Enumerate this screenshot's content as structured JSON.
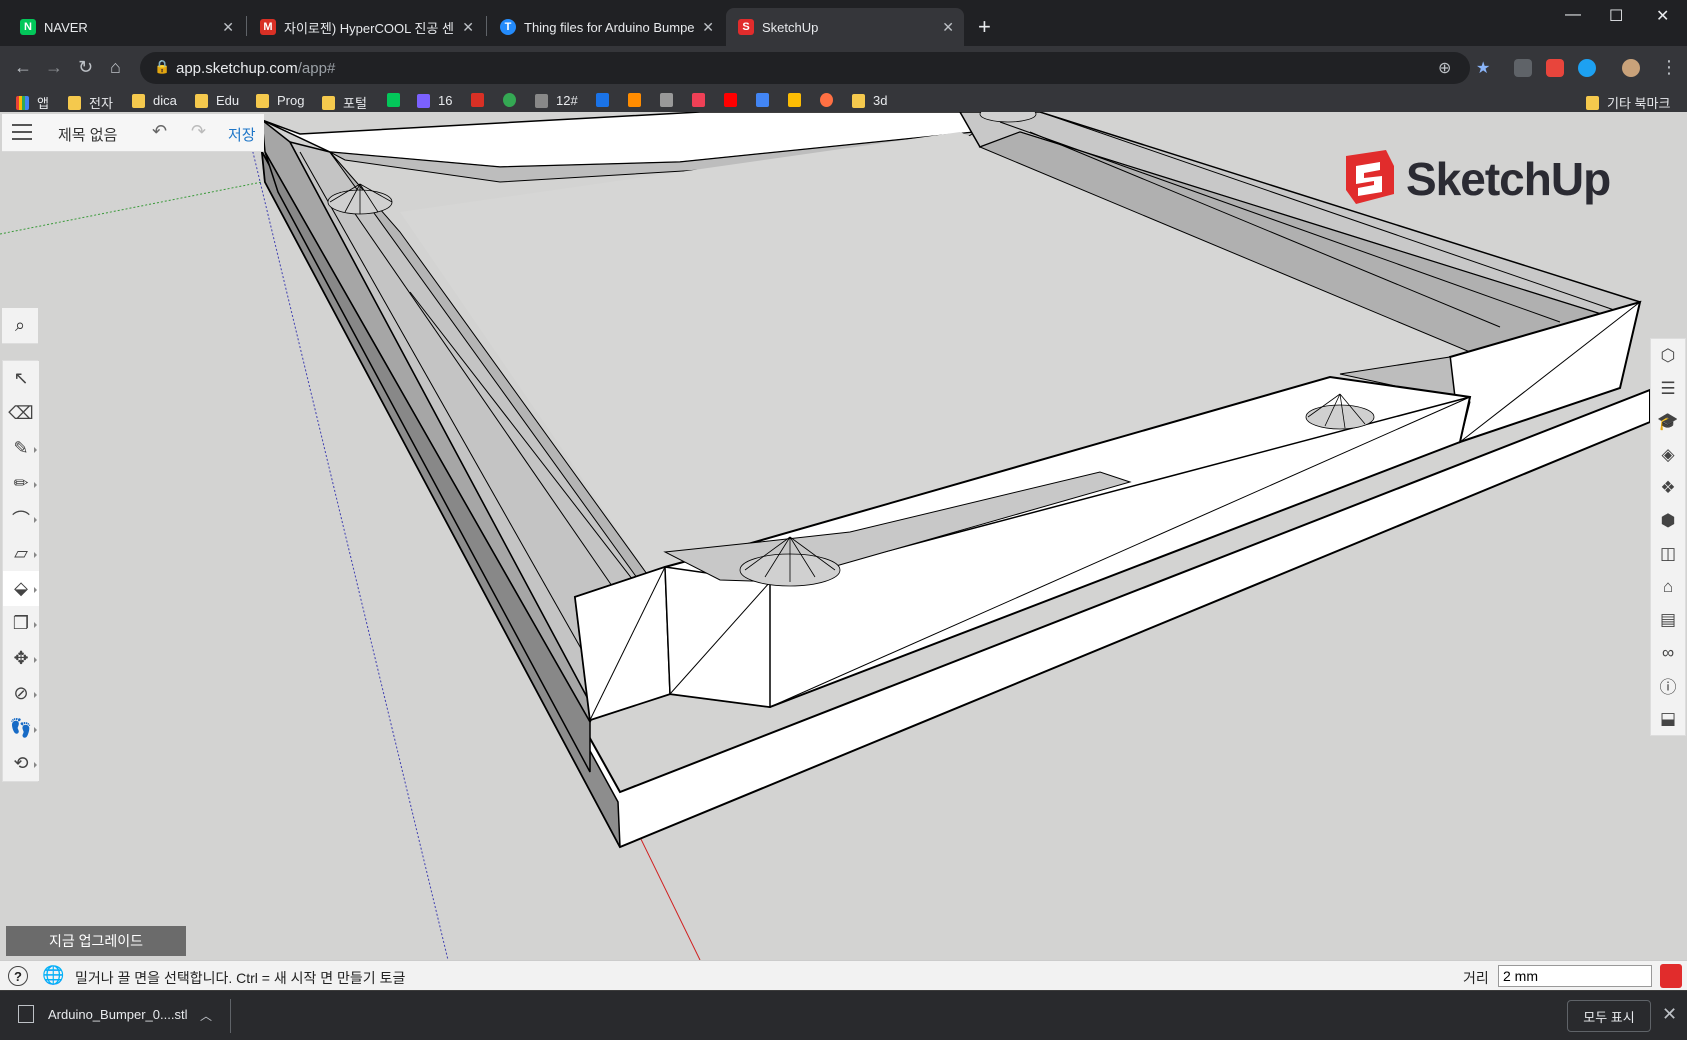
{
  "browser": {
    "tabs": [
      {
        "title": "NAVER",
        "favicon": "naver-icon",
        "color": "#03c75a",
        "glyph": "N"
      },
      {
        "title": "자이로젠) HyperCOOL 진공 센서",
        "favicon": "gmail-icon",
        "color": "#d93025",
        "glyph": "M"
      },
      {
        "title": "Thing files for Arduino Bumper",
        "favicon": "thingiverse-icon",
        "color": "#248bfb",
        "glyph": "T"
      },
      {
        "title": "SketchUp",
        "favicon": "sketchup-icon",
        "color": "#e12c2c",
        "glyph": "S"
      }
    ],
    "new_tab": "+",
    "window_controls": {
      "minimize": "—",
      "maximize": "☐",
      "close": "✕"
    },
    "url_host": "app.sketchup.com",
    "url_path": "/app#",
    "bookmarks": [
      {
        "label": "앱",
        "type": "apps"
      },
      {
        "label": "전자",
        "type": "folder"
      },
      {
        "label": "dica",
        "type": "folder"
      },
      {
        "label": "Edu",
        "type": "folder"
      },
      {
        "label": "Prog",
        "type": "folder"
      },
      {
        "label": "포털",
        "type": "folder"
      },
      {
        "label": "",
        "type": "naver",
        "color": "#03c75a"
      },
      {
        "label": "16",
        "type": "site",
        "color": "#7b61ff"
      },
      {
        "label": "",
        "type": "gmail",
        "color": "#d93025"
      },
      {
        "label": "",
        "type": "site",
        "color": "#34a853"
      },
      {
        "label": "12#",
        "type": "site",
        "color": "#cccccc"
      },
      {
        "label": "",
        "type": "calendar",
        "color": "#1a73e8"
      },
      {
        "label": "",
        "type": "site",
        "color": "#ff8c00"
      },
      {
        "label": "",
        "type": "site",
        "color": "#999999"
      },
      {
        "label": "",
        "type": "pocket",
        "color": "#ef4056"
      },
      {
        "label": "",
        "type": "youtube",
        "color": "#ff0000"
      },
      {
        "label": "",
        "type": "translate",
        "color": "#4285f4"
      },
      {
        "label": "",
        "type": "maps",
        "color": "#fbbc04"
      },
      {
        "label": "",
        "type": "site",
        "color": "#ff7043"
      },
      {
        "label": "3d",
        "type": "folder"
      }
    ],
    "other_bookmarks": "기타 북마크"
  },
  "sketchup": {
    "doc_title": "제목 없음",
    "save_label": "저장",
    "brand": "SketchUp",
    "upgrade_label": "지금 업그레이드",
    "left_tools": [
      "select-icon",
      "eraser-icon",
      "paint-icon",
      "pencil-icon",
      "arc-icon",
      "rectangle-icon",
      "push-pull-icon",
      "offset-icon",
      "move-icon",
      "tape-measure-icon",
      "walk-icon",
      "orbit-icon"
    ],
    "selected_tool": "push-pull-icon",
    "right_tools": [
      "entity-info-icon",
      "outliner-icon",
      "instructor-icon",
      "materials-icon",
      "components-icon",
      "solid-tools-icon",
      "styles-icon",
      "tags-icon",
      "scenes-icon",
      "display-icon",
      "model-info-icon",
      "3d-warehouse-icon"
    ],
    "status_message": "밀거나 끌 면을 선택합니다. Ctrl = 새 시작 면 만들기 토글",
    "distance_label": "거리",
    "distance_value": "2 mm"
  },
  "downloads": {
    "file_name": "Arduino_Bumper_0....stl",
    "show_all": "모두 표시"
  }
}
